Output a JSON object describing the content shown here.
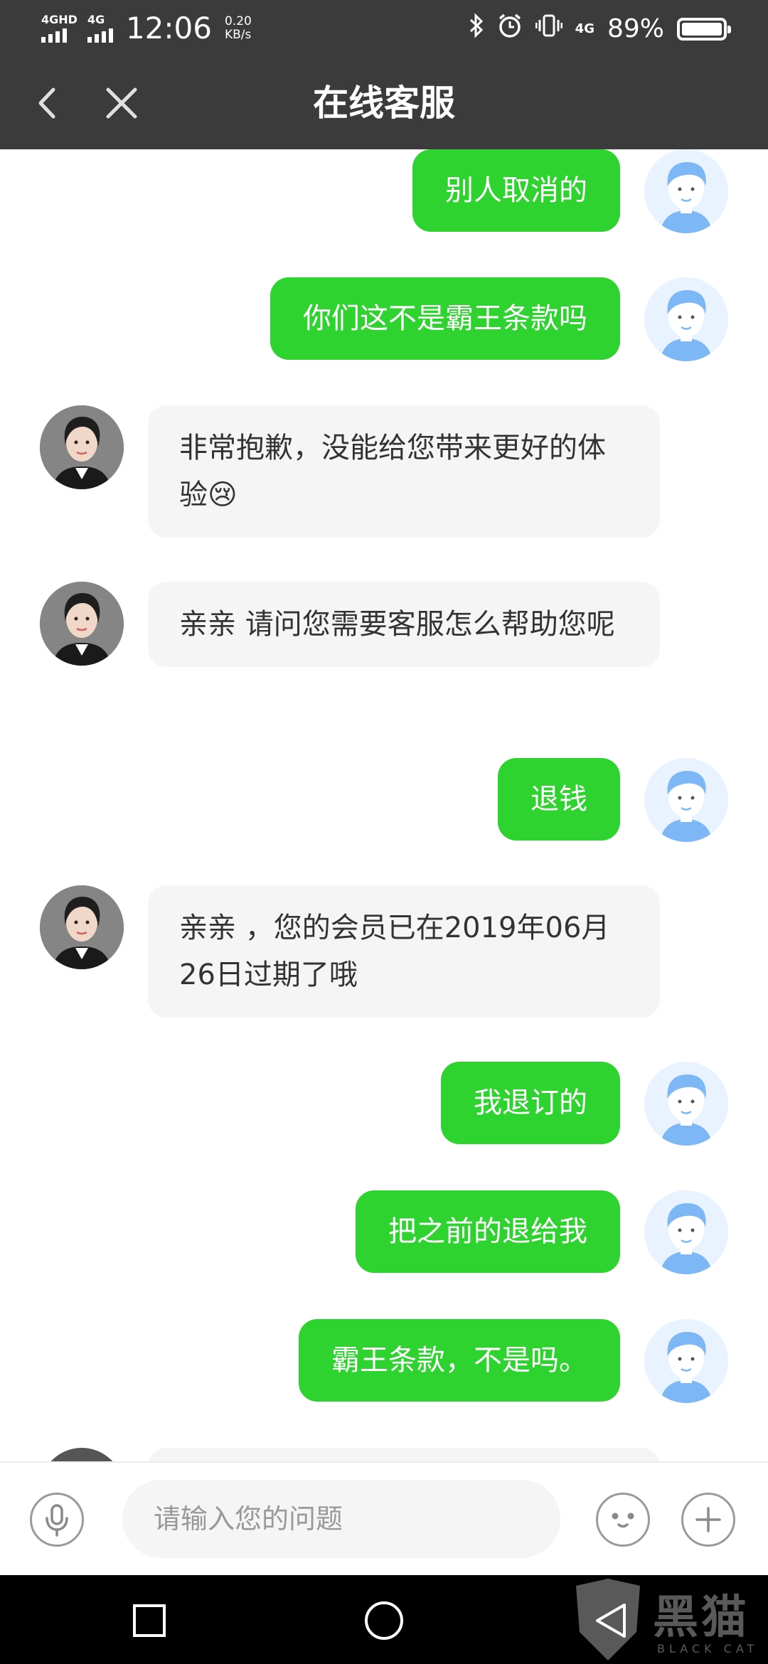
{
  "status_bar": {
    "signal1_label": "4GHD",
    "signal2_label": "4G",
    "time": "12:06",
    "speed_value": "0.20",
    "speed_unit": "KB/s",
    "network_badge": "4G",
    "battery_percent": "89%",
    "battery_level": 0.89,
    "icons": [
      "bluetooth-icon",
      "alarm-icon",
      "vibrate-icon"
    ]
  },
  "header": {
    "title": "在线客服",
    "back_icon": "chevron-left-icon",
    "close_icon": "close-icon"
  },
  "messages": [
    {
      "from": "user",
      "text": "别人取消的"
    },
    {
      "from": "user",
      "text": "你们这不是霸王条款吗"
    },
    {
      "from": "agent",
      "text": "非常抱歉，没能给您带来更好的体验😢"
    },
    {
      "from": "agent",
      "text": "亲亲 请问您需要客服怎么帮助您呢"
    },
    {
      "from": "user",
      "text": "退钱"
    },
    {
      "from": "agent",
      "text": "亲亲 ，您的会员已在2019年06月26日过期了哦"
    },
    {
      "from": "user",
      "text": "我退订的"
    },
    {
      "from": "user",
      "text": "把之前的退给我"
    },
    {
      "from": "user",
      "text": "霸王条款，不是吗。"
    }
  ],
  "input_bar": {
    "placeholder": "请输入您的问题",
    "value": "",
    "icons": [
      "microphone-icon",
      "emoji-icon",
      "plus-icon"
    ]
  },
  "nav_bar": {
    "icons": [
      "recent-apps-icon",
      "home-icon",
      "back-icon"
    ],
    "watermark_text": "黑猫",
    "watermark_sub": "BLACK CAT"
  },
  "colors": {
    "header_bg": "#3b3b3b",
    "user_bubble": "#2fd32f",
    "agent_bubble": "#f5f5f5",
    "nav_bg": "#000000"
  }
}
